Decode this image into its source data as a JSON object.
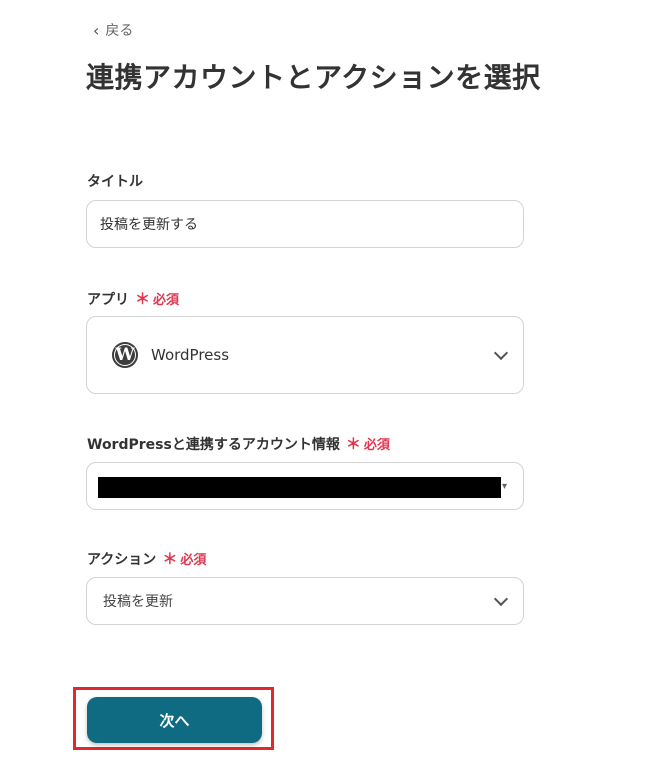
{
  "nav": {
    "back_label": "戻る"
  },
  "page": {
    "title": "連携アカウントとアクションを選択"
  },
  "form": {
    "title_field": {
      "label": "タイトル",
      "value": "投稿を更新する"
    },
    "required_mark": "＊",
    "required_text": "必須",
    "app_field": {
      "label": "アプリ",
      "value": "WordPress",
      "icon": "wordpress-icon"
    },
    "account_field": {
      "label": "WordPressと連携するアカウント情報"
    },
    "action_field": {
      "label": "アクション",
      "value": "投稿を更新"
    }
  },
  "footer": {
    "next_label": "次へ"
  },
  "colors": {
    "primary": "#0f6b82",
    "required": "#e0374f",
    "highlight": "#e0282e"
  }
}
